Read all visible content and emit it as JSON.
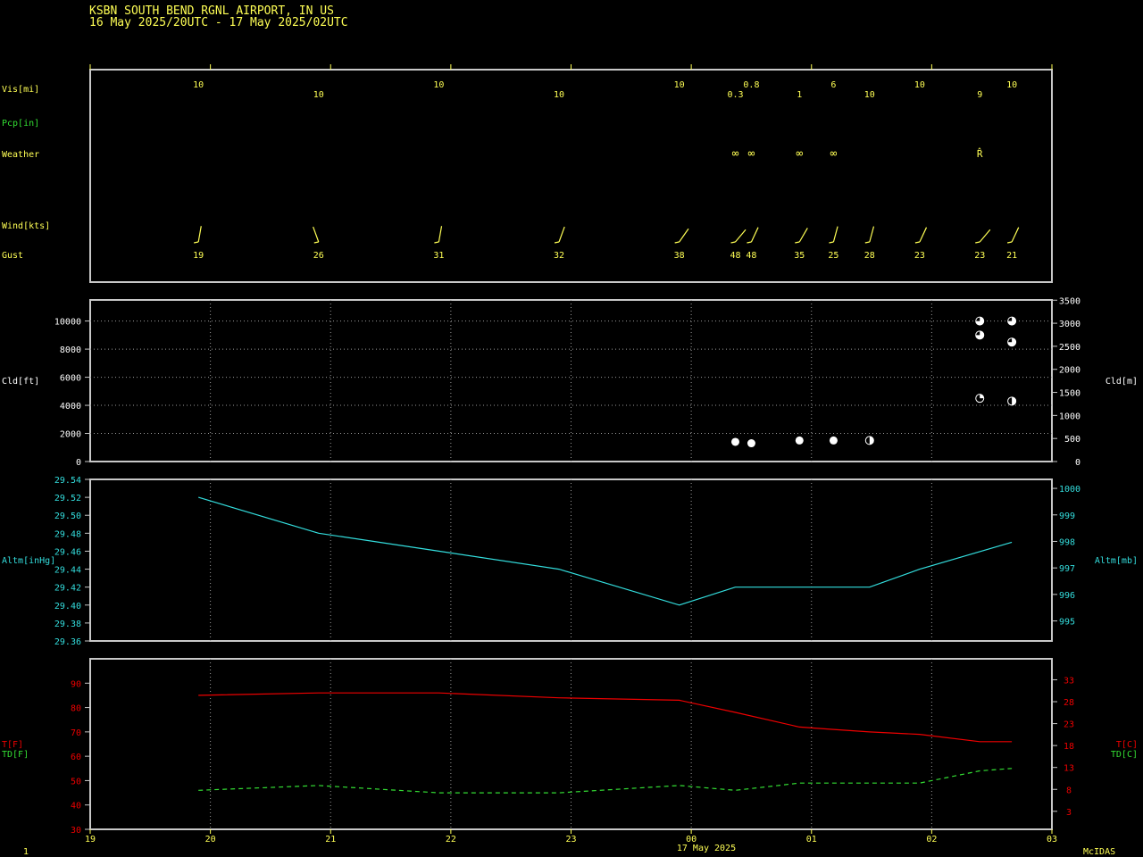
{
  "header": {
    "station": "KSBN  SOUTH BEND RGNL AIRPORT, IN US",
    "period": "16 May 2025/20UTC - 17 May 2025/02UTC"
  },
  "colors": {
    "yellow": "#ffff55",
    "green": "#33dd33",
    "cyan": "#33dddd",
    "red": "#ee0000",
    "frame": "#c8c8c8",
    "grid": "#9a9a9a",
    "white": "#ffffff"
  },
  "labels": {
    "vis": "Vis[mi]",
    "pcp": "Pcp[in]",
    "weather": "Weather",
    "wind": "Wind[kts]",
    "gust": "Gust",
    "cld_ft": "Cld[ft]",
    "cld_m": "Cld[m]",
    "altm_inhg": "Altm[inHg]",
    "altm_mb": "Altm[mb]",
    "t_f": "T[F]",
    "td_f": "TD[F]",
    "t_c": "T[C]",
    "td_c": "TD[C]",
    "date_label": "17 May 2025",
    "footer_left": "1",
    "footer_right": "McIDAS"
  },
  "chart_data": {
    "type": "line",
    "time_axis": {
      "unit": "hour UTC",
      "range": [
        19,
        27
      ],
      "tick_labels": [
        "19",
        "20",
        "21",
        "22",
        "23",
        "00",
        "01",
        "02",
        "03"
      ],
      "date_label": "17 May 2025"
    },
    "observations": [
      {
        "time": "19:54",
        "vis": "10",
        "gust": "19",
        "wx": "",
        "clouds": []
      },
      {
        "time": "20:54",
        "vis": "10",
        "gust": "26",
        "wx": "",
        "clouds": []
      },
      {
        "time": "21:54",
        "vis": "10",
        "gust": "31",
        "wx": "",
        "clouds": []
      },
      {
        "time": "22:54",
        "vis": "10",
        "gust": "32",
        "wx": "",
        "clouds": []
      },
      {
        "time": "23:54",
        "vis": "10",
        "gust": "38",
        "wx": "",
        "clouds": []
      },
      {
        "time": "00:22",
        "vis": "0.3",
        "gust": "48",
        "wx": "haze",
        "clouds": [
          {
            "ft": 1400,
            "cover": "OVC"
          }
        ]
      },
      {
        "time": "00:30",
        "vis": "0.8",
        "gust": "48",
        "wx": "haze",
        "clouds": [
          {
            "ft": 1300,
            "cover": "OVC"
          }
        ]
      },
      {
        "time": "00:54",
        "vis": "1",
        "gust": "35",
        "wx": "haze",
        "clouds": [
          {
            "ft": 1500,
            "cover": "OVC"
          }
        ]
      },
      {
        "time": "01:11",
        "vis": "6",
        "gust": "25",
        "wx": "haze",
        "clouds": [
          {
            "ft": 1500,
            "cover": "OVC"
          }
        ]
      },
      {
        "time": "01:29",
        "vis": "10",
        "gust": "28",
        "wx": "",
        "clouds": [
          {
            "ft": 1500,
            "cover": "SCT"
          }
        ]
      },
      {
        "time": "01:54",
        "vis": "10",
        "gust": "23",
        "wx": "",
        "clouds": []
      },
      {
        "time": "02:24",
        "vis": "9",
        "gust": "23",
        "wx": "thunder",
        "clouds": [
          {
            "ft": 4500,
            "cover": "FEW"
          },
          {
            "ft": 9000,
            "cover": "BKN"
          },
          {
            "ft": 10000,
            "cover": "BKN"
          }
        ]
      },
      {
        "time": "02:40",
        "vis": "10",
        "gust": "21",
        "wx": "",
        "clouds": [
          {
            "ft": 4300,
            "cover": "SCT"
          },
          {
            "ft": 8500,
            "cover": "BKN"
          },
          {
            "ft": 10000,
            "cover": "BKN"
          }
        ]
      }
    ],
    "wind_barbs": [
      {
        "time": "19:54",
        "dir": 190
      },
      {
        "time": "20:54",
        "dir": 160
      },
      {
        "time": "21:54",
        "dir": 190
      },
      {
        "time": "22:54",
        "dir": 200
      },
      {
        "time": "23:54",
        "dir": 215
      },
      {
        "time": "00:22",
        "dir": 220
      },
      {
        "time": "00:30",
        "dir": 205
      },
      {
        "time": "00:54",
        "dir": 210
      },
      {
        "time": "01:11",
        "dir": 195
      },
      {
        "time": "01:29",
        "dir": 195
      },
      {
        "time": "01:54",
        "dir": 205
      },
      {
        "time": "02:24",
        "dir": 220
      },
      {
        "time": "02:40",
        "dir": 205
      }
    ],
    "cloud_axis": {
      "left_ticks_ft": [
        0,
        2000,
        4000,
        6000,
        8000,
        10000
      ],
      "right_ticks_m": [
        0,
        500,
        1000,
        1500,
        2000,
        2500,
        3000,
        3500
      ]
    },
    "altimeter": {
      "unit": "inHg",
      "left_ticks": [
        "29.36",
        "29.38",
        "29.40",
        "29.42",
        "29.44",
        "29.46",
        "29.48",
        "29.50",
        "29.52",
        "29.54"
      ],
      "right_ticks_mb": [
        "995",
        "996",
        "997",
        "998",
        "999",
        "1000"
      ],
      "points": [
        [
          "19:54",
          29.52
        ],
        [
          "20:54",
          29.48
        ],
        [
          "21:54",
          29.46
        ],
        [
          "22:54",
          29.44
        ],
        [
          "23:54",
          29.4
        ],
        [
          "00:22",
          29.42
        ],
        [
          "01:29",
          29.42
        ],
        [
          "01:54",
          29.44
        ],
        [
          "02:40",
          29.47
        ]
      ]
    },
    "temperature": {
      "unit": "F",
      "left_ticks": [
        "30",
        "40",
        "50",
        "60",
        "70",
        "80",
        "90"
      ],
      "right_ticks_c": [
        "3",
        "8",
        "13",
        "18",
        "23",
        "28",
        "33"
      ],
      "series": [
        {
          "name": "T[F]",
          "color": "#ee0000",
          "style": "solid",
          "points": [
            [
              "19:54",
              85
            ],
            [
              "20:54",
              86
            ],
            [
              "21:54",
              86
            ],
            [
              "22:54",
              84
            ],
            [
              "23:54",
              83
            ],
            [
              "00:22",
              78
            ],
            [
              "00:54",
              72
            ],
            [
              "01:11",
              71
            ],
            [
              "01:29",
              70
            ],
            [
              "01:54",
              69
            ],
            [
              "02:24",
              66
            ],
            [
              "02:40",
              66
            ]
          ]
        },
        {
          "name": "TD[F]",
          "color": "#33dd33",
          "style": "dashed",
          "points": [
            [
              "19:54",
              46
            ],
            [
              "20:54",
              48
            ],
            [
              "21:54",
              45
            ],
            [
              "22:54",
              45
            ],
            [
              "23:54",
              48
            ],
            [
              "00:22",
              46
            ],
            [
              "00:54",
              49
            ],
            [
              "01:11",
              49
            ],
            [
              "01:29",
              49
            ],
            [
              "01:54",
              49
            ],
            [
              "02:24",
              54
            ],
            [
              "02:40",
              55
            ]
          ]
        }
      ]
    }
  }
}
